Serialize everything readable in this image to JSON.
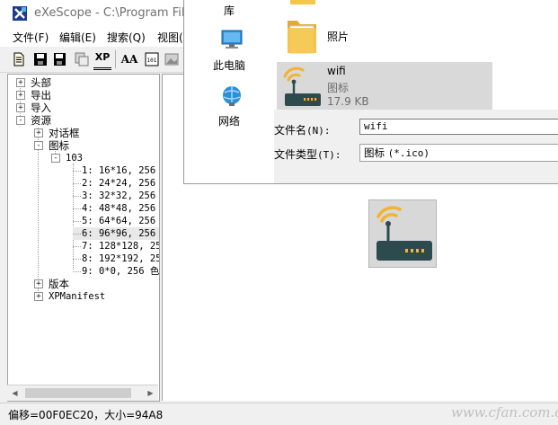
{
  "window": {
    "title": "eXeScope - C:\\Program Files"
  },
  "menu": [
    "文件(F)",
    "编辑(E)",
    "搜索(Q)",
    "视图("
  ],
  "toolbar": {
    "buttons": [
      "new-doc-icon",
      "save-icon",
      "save-all-icon",
      "copy-icon",
      "xp-manifest-icon",
      "font-icon",
      "resource-icon",
      "image-icon"
    ],
    "xp_label": "XP",
    "font_label": "AA"
  },
  "tree": {
    "root": [
      "头部",
      "导出",
      "导入",
      "资源"
    ],
    "resources": [
      "对话框",
      "图标"
    ],
    "icon_group": "103",
    "icon_entries": [
      "1: 16*16, 256",
      "2: 24*24, 256",
      "3: 32*32, 256",
      "4: 48*48, 256",
      "5: 64*64, 256",
      "6: 96*96, 256",
      "7: 128*128, 25",
      "8: 192*192, 25",
      "9: 0*0, 256 色"
    ],
    "after": [
      "版本",
      "XPManifest"
    ],
    "expander_plus": "+",
    "expander_minus": "-"
  },
  "status": {
    "text": "偏移=00F0EC20，大小=94A8"
  },
  "watermark": "www.cfan.com.cn",
  "dialog": {
    "nav": [
      "库",
      "此电脑",
      "网络"
    ],
    "files": {
      "folder_name": "照片",
      "wifi_name": "wifi",
      "wifi_type": "图标",
      "wifi_size": "17.9 KB"
    },
    "form": {
      "filename_label": "文件名",
      "filename_hotkey": "(N):",
      "filename_value": "wifi",
      "filetype_label": "文件类型",
      "filetype_hotkey": "(T):",
      "filetype_value_cn": "图标",
      "filetype_value_ext": "(*.ico)"
    }
  },
  "colors": {
    "router_body": "#2d4a4e",
    "router_light": "#f2b233",
    "wifi_arc": "#f2b233",
    "folder": "#f5c64b",
    "selection": "#d9d9d9"
  }
}
